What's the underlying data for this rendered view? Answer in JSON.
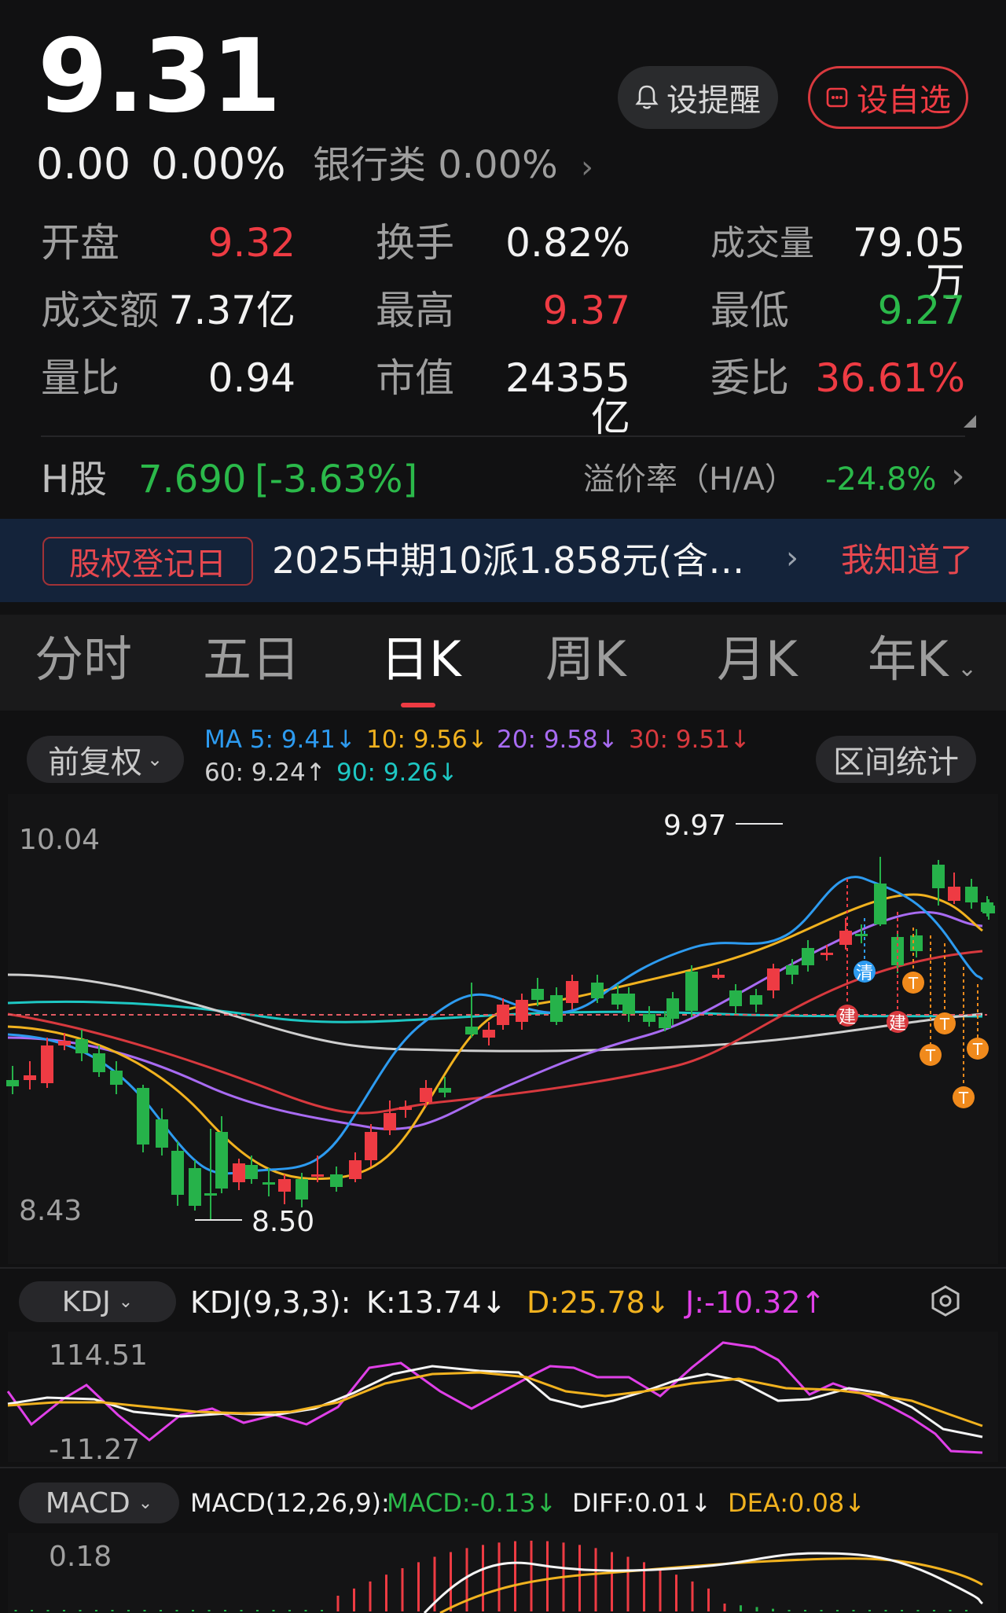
{
  "quote": {
    "price": "9.31",
    "change": "0.00",
    "change_pct": "0.00%",
    "sector": "银行类 0.00%",
    "sector_arrow": "›"
  },
  "actions": {
    "alert_label": "设提醒",
    "watch_label": "设自选"
  },
  "stats": {
    "open_label": "开盘",
    "open_value": "9.32",
    "turnover_label": "换手",
    "turnover_value": "0.82%",
    "volume_label": "成交量",
    "volume_value": "79.05万",
    "amount_label": "成交额",
    "amount_value": "7.37亿",
    "high_label": "最高",
    "high_value": "9.37",
    "low_label": "最低",
    "low_value": "9.27",
    "vol_ratio_label": "量比",
    "vol_ratio_value": "0.94",
    "mkt_cap_label": "市值",
    "mkt_cap_value": "24355亿",
    "commission_label": "委比",
    "commission_value": "36.61%"
  },
  "hshare": {
    "label": "H股",
    "price": "7.690",
    "change": "[-3.63%]",
    "premium_label": "溢价率（H/A）",
    "premium_value": "-24.8%",
    "arrow": "›"
  },
  "banner": {
    "tag": "股权登记日",
    "text": "2025中期10派1.858元(含…",
    "arrow": "›",
    "dismiss": "我知道了"
  },
  "tabs": [
    "分时",
    "五日",
    "日K",
    "周K",
    "月K",
    "年K"
  ],
  "tabs_active": 2,
  "tab_more": "⌄",
  "kline": {
    "adjust_label": "前复权",
    "range_stats_label": "区间统计",
    "ma5": "MA 5: 9.41↓",
    "ma10": "10: 9.56↓",
    "ma20": "20: 9.58↓",
    "ma30": "30: 9.51↓",
    "ma60": "60: 9.24↑",
    "ma90": "90: 9.26↓",
    "y_top": "10.04",
    "y_bottom": "8.43",
    "high_mark": "9.97",
    "low_mark": "8.50",
    "markers": {
      "clear": "清",
      "build": "建",
      "t": "T"
    },
    "colors": {
      "ma5": "#2d9bf0",
      "ma10": "#f1b21f",
      "ma20": "#a86bf2",
      "ma30": "#d8393e",
      "ma60": "#cfcfcf",
      "ma90": "#1ec7c3",
      "up": "#ee3b43",
      "down": "#26b24a"
    }
  },
  "kdj": {
    "selector": "KDJ",
    "params": "KDJ(9,3,3):",
    "k": "K:13.74↓",
    "d": "D:25.78↓",
    "j": "J:-10.32↑",
    "y_top": "114.51",
    "y_bottom": "-11.27"
  },
  "macd": {
    "selector": "MACD",
    "params": "MACD(12,26,9):",
    "macd": "MACD:-0.13↓",
    "diff": "DIFF:0.01↓",
    "dea": "DEA:0.08↓",
    "y_top": "0.18"
  }
}
